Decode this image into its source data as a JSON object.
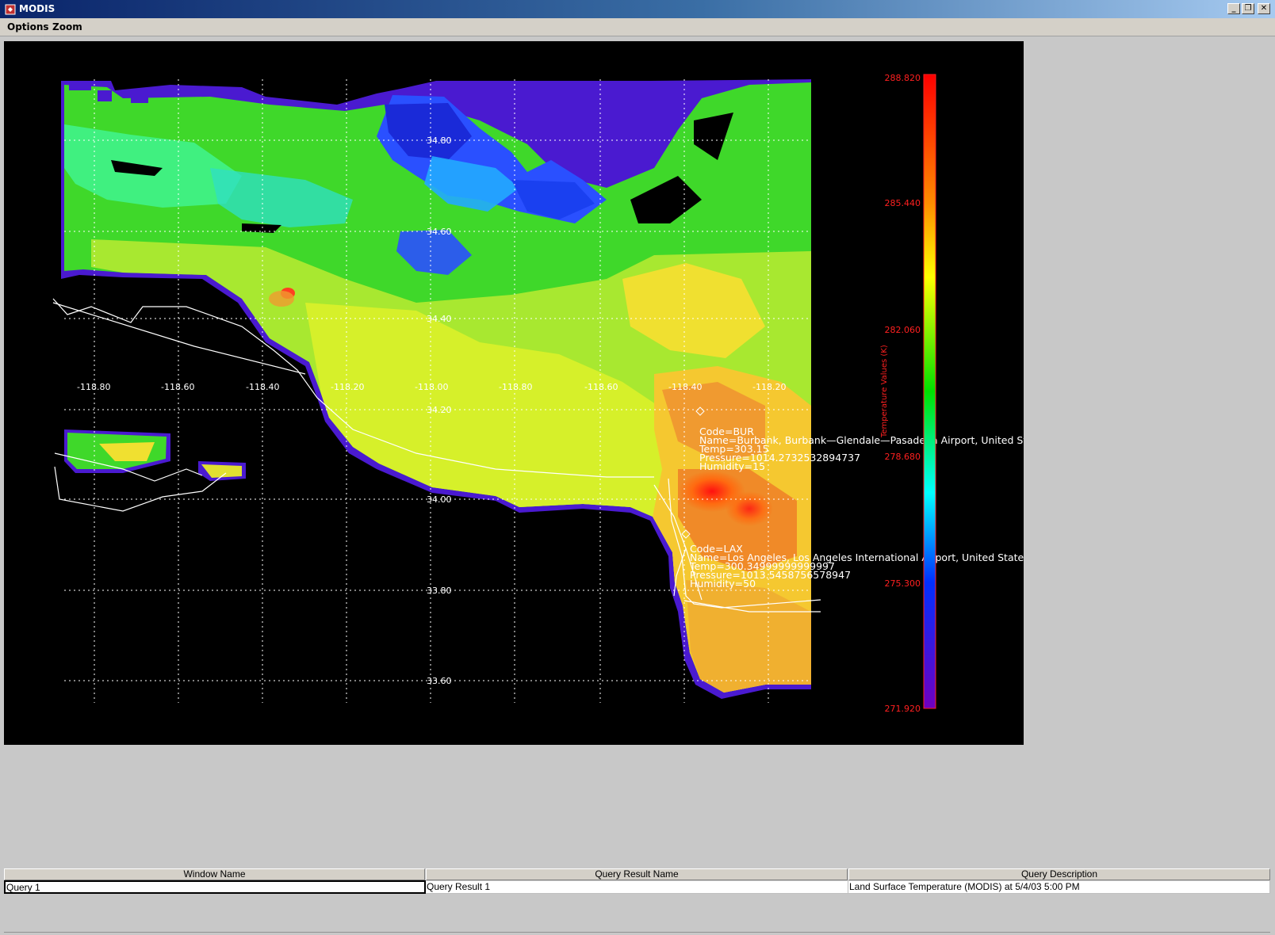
{
  "window": {
    "title": "MODIS",
    "buttons": {
      "minimize": "_",
      "restore": "❐",
      "close": "✕"
    }
  },
  "menubar": {
    "items": [
      "Options",
      "Zoom"
    ]
  },
  "plot": {
    "lon_labels": [
      "-118.80",
      "-118.60",
      "-118.40",
      "-118.20",
      "-118.00",
      "-118.80",
      "-118.60",
      "-118.40",
      "-118.20"
    ],
    "lat_labels": [
      "34.80",
      "34.60",
      "34.40",
      "34.20",
      "34.00",
      "33.80",
      "33.60"
    ],
    "colorbar": {
      "title": "Temperature Values (K)",
      "tick_labels": [
        "288.820",
        "285.440",
        "282.060",
        "278.680",
        "275.300",
        "271.920"
      ]
    },
    "annotations": [
      {
        "code": "Code=BUR",
        "name": "Name=Burbank, Burbank—Glendale—Pasadena Airport, United Sta",
        "temp": "Temp=303.15",
        "pressure": "Pressure=1014.2732532894737",
        "humidity": "Humidity=15"
      },
      {
        "code": "Code=LAX",
        "name": "Name=Los Angeles, Los Angeles International Airport, United States",
        "temp": "Temp=300.34999999999997",
        "pressure": "Pressure=1013.5458756578947",
        "humidity": "Humidity=50"
      }
    ],
    "colors": {
      "background": "#000000",
      "grid": "#ffffff",
      "label_red": "#ff2020",
      "scale": [
        "#ff0000",
        "#ff8000",
        "#ffff00",
        "#00ff00",
        "#00ffff",
        "#0000ff",
        "#6a00c8"
      ]
    }
  },
  "table": {
    "headers": [
      "Window Name",
      "Query Result Name",
      "Query Description"
    ],
    "rows": [
      [
        "Query 1",
        "Query Result 1",
        "Land Surface Temperature (MODIS) at 5/4/03 5:00 PM"
      ]
    ]
  }
}
